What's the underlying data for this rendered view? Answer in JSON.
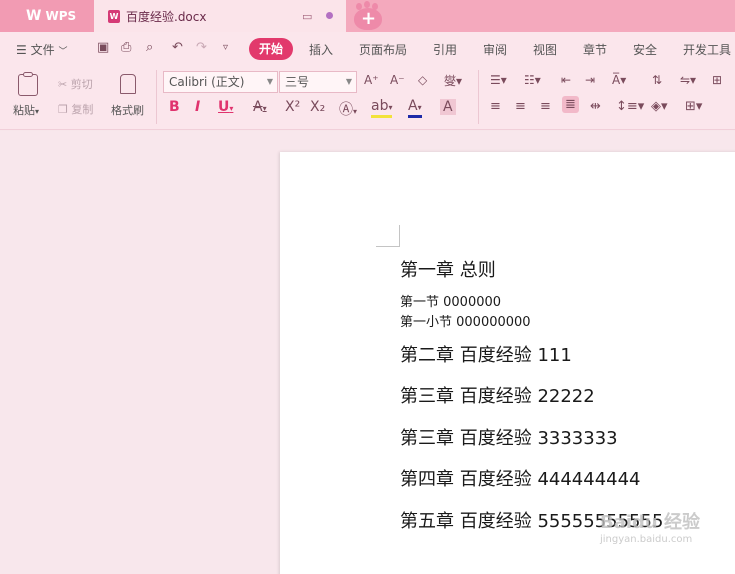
{
  "titlebar": {
    "app_name": "WPS",
    "doc_tab_title": "百度经验.docx"
  },
  "menubar": {
    "file_label": "文件",
    "tabs": [
      "开始",
      "插入",
      "页面布局",
      "引用",
      "审阅",
      "视图",
      "章节",
      "安全",
      "开发工具"
    ],
    "active_tab": "开始"
  },
  "ribbon": {
    "paste_label": "粘贴",
    "cut_label": "剪切",
    "copy_label": "复制",
    "format_painter_label": "格式刷",
    "font_name": "Calibri (正文)",
    "font_size": "三号"
  },
  "document": {
    "lines": [
      "第一章  总则",
      "第一节  0000000",
      "第一小节  000000000",
      "第二章  百度经验 111",
      "第三章  百度经验 22222",
      "第三章  百度经验 3333333",
      "第四章  百度经验 444444444",
      "第五章  百度经验 55555555555"
    ]
  },
  "watermark": {
    "text": "Baidu 经验",
    "url": "jingyan.baidu.com"
  },
  "colors": {
    "accent": "#e2396c",
    "titlebar": "#f4a9bd",
    "ribbon_bg": "#fbe6ec"
  }
}
